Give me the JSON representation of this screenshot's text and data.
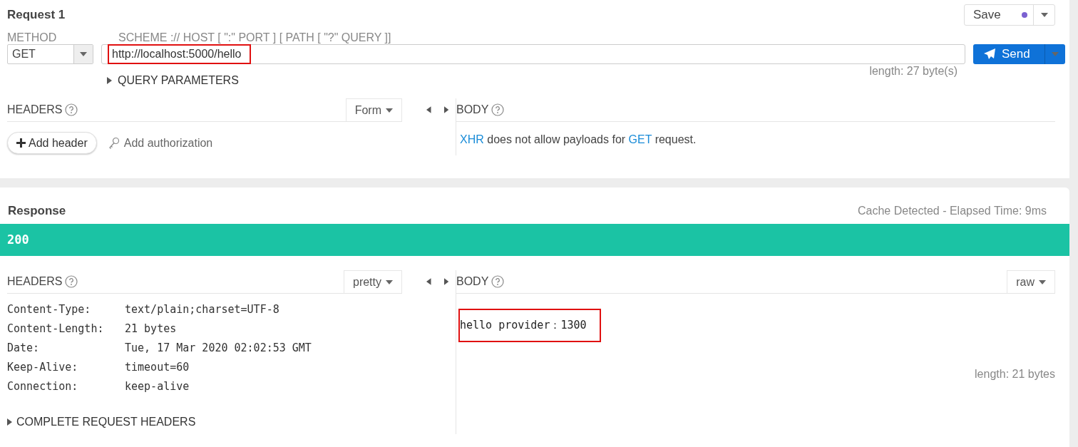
{
  "request": {
    "title": "Request 1",
    "save": "Save",
    "method_label": "METHOD",
    "method": "GET",
    "url_hint": "SCHEME :// HOST [ \":\" PORT ] [ PATH [ \"?\" QUERY ]]",
    "url": "http://localhost:5000/hello",
    "url_highlighted": true,
    "length": "length: 27 byte(s)",
    "send": "Send",
    "query_parameters": "QUERY PARAMETERS",
    "headers": {
      "label": "HEADERS",
      "mode": "Form",
      "add_header": "Add header",
      "add_authorization": "Add authorization"
    },
    "body": {
      "label": "BODY",
      "message": [
        {
          "kind": "link",
          "text": "XHR"
        },
        {
          "kind": "text",
          "text": " does not allow payloads for "
        },
        {
          "kind": "link",
          "text": "GET"
        },
        {
          "kind": "text",
          "text": " request."
        }
      ]
    }
  },
  "response": {
    "title": "Response",
    "elapsed": "Cache Detected - Elapsed Time: 9ms",
    "status": "200",
    "headers": {
      "label": "HEADERS",
      "mode": "pretty",
      "rows": [
        {
          "name": "Content-Type:",
          "value": "text/plain;charset=UTF-8"
        },
        {
          "name": "Content-Length:",
          "value": "21 bytes"
        },
        {
          "name": "Date:",
          "value": "Tue, 17 Mar 2020 02:02:53 GMT"
        },
        {
          "name": "Keep-Alive:",
          "value": "timeout=60"
        },
        {
          "name": "Connection:",
          "value": "keep-alive"
        }
      ],
      "complete": "COMPLETE REQUEST HEADERS"
    },
    "body": {
      "label": "BODY",
      "mode": "raw",
      "content": "hello provider：1300",
      "highlighted": true,
      "length": "length: 21 bytes"
    }
  }
}
